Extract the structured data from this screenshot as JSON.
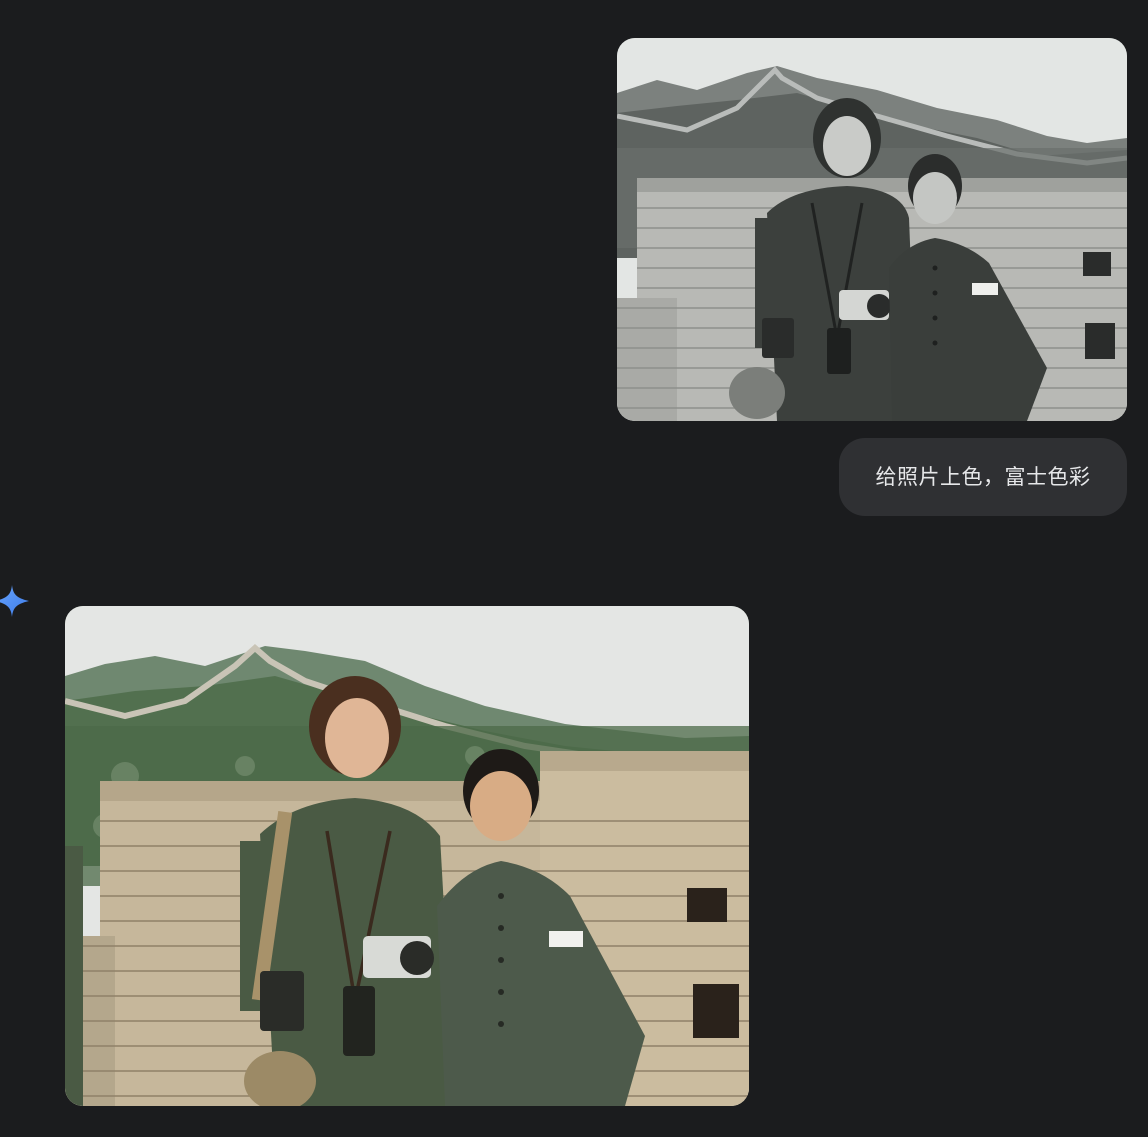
{
  "conversation": {
    "user_message": {
      "image_kind": "black-and-white photograph",
      "text": "给照片上色，富士色彩"
    },
    "assistant_message": {
      "icon": "gemini-sparkle-icon",
      "image_kind": "colorized photograph"
    }
  },
  "colors": {
    "background": "#1b1c1e",
    "bubble": "#2f3033",
    "bubble_text": "#e6e7e9",
    "accent": "#4c8df6"
  }
}
